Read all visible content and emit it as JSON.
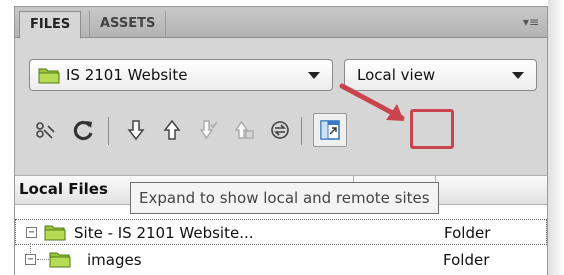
{
  "tabs": [
    {
      "label": "FILES",
      "active": true
    },
    {
      "label": "ASSETS",
      "active": false
    }
  ],
  "panel_menu": {
    "icon": "panel-options-menu-icon",
    "glyph": "▾≡"
  },
  "site_select": {
    "value": "IS 2101 Website",
    "icon": "folder-icon"
  },
  "view_select": {
    "value": "Local view"
  },
  "toolbar": {
    "buttons": [
      {
        "name": "connect-icon",
        "enabled": true
      },
      {
        "name": "refresh-icon",
        "enabled": true
      },
      {
        "name": "get-files-icon",
        "enabled": true
      },
      {
        "name": "put-files-icon",
        "enabled": true
      },
      {
        "name": "check-out-icon",
        "enabled": false
      },
      {
        "name": "check-in-icon",
        "enabled": false
      },
      {
        "name": "synchronize-icon",
        "enabled": true
      },
      {
        "name": "expand-icon",
        "enabled": true
      }
    ]
  },
  "file_list": {
    "columns": [
      "Local Files"
    ],
    "rows": [
      {
        "name": "Site - IS 2101 Website...",
        "type": "Folder",
        "expanded": true,
        "selected": true
      },
      {
        "name": "images",
        "type": "Folder",
        "expanded": true,
        "selected": false
      }
    ]
  },
  "tooltip": {
    "text": "Expand to show local and remote sites"
  },
  "colors": {
    "highlight": "#c9444e",
    "folder": "#9bc53d",
    "panel_bg": "#d6d6d6"
  }
}
